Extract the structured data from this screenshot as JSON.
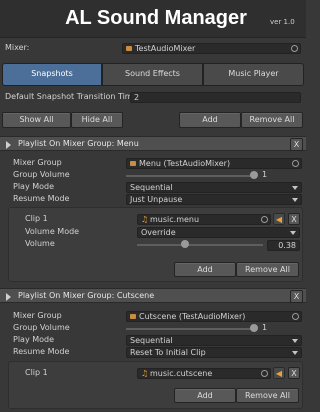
{
  "header": {
    "title": "AL Sound Manager",
    "version": "ver 1.0"
  },
  "mixer": {
    "label": "Mixer:",
    "value": "TestAudioMixer"
  },
  "tabs": [
    {
      "label": "Snapshots",
      "active": true
    },
    {
      "label": "Sound Effects",
      "active": false
    },
    {
      "label": "Music Player",
      "active": false
    }
  ],
  "transition": {
    "label": "Default Snapshot Transition Time:",
    "value": "2"
  },
  "toolbar": {
    "show_all": "Show All",
    "hide_all": "Hide All",
    "add": "Add",
    "remove_all": "Remove All"
  },
  "playlists": [
    {
      "title": "Playlist On Mixer Group: Menu",
      "close": "X",
      "mixer_group_label": "Mixer Group",
      "mixer_group_value": "Menu (TestAudioMixer)",
      "group_volume_label": "Group Volume",
      "group_volume_value": "1",
      "play_mode_label": "Play Mode",
      "play_mode_value": "Sequential",
      "resume_mode_label": "Resume Mode",
      "resume_mode_value": "Just Unpause",
      "clip": {
        "label": "Clip 1",
        "value": "music.menu",
        "close": "X",
        "volume_mode_label": "Volume Mode",
        "volume_mode_value": "Override",
        "volume_label": "Volume",
        "volume_value": "0.38"
      },
      "add": "Add",
      "remove_all": "Remove All"
    },
    {
      "title": "Playlist On Mixer Group: Cutscene",
      "close": "X",
      "mixer_group_label": "Mixer Group",
      "mixer_group_value": "Cutscene (TestAudioMixer)",
      "group_volume_label": "Group Volume",
      "group_volume_value": "1",
      "play_mode_label": "Play Mode",
      "play_mode_value": "Sequential",
      "resume_mode_label": "Resume Mode",
      "resume_mode_value": "Reset To Initial Clip",
      "clip": {
        "label": "Clip 1",
        "value": "music.cutscene",
        "close": "X"
      },
      "add": "Add",
      "remove_all": "Remove All"
    }
  ],
  "colors": {
    "background": "#383838",
    "tab_active": "#4c6f9a",
    "speaker_icon": "#e8a23a"
  }
}
